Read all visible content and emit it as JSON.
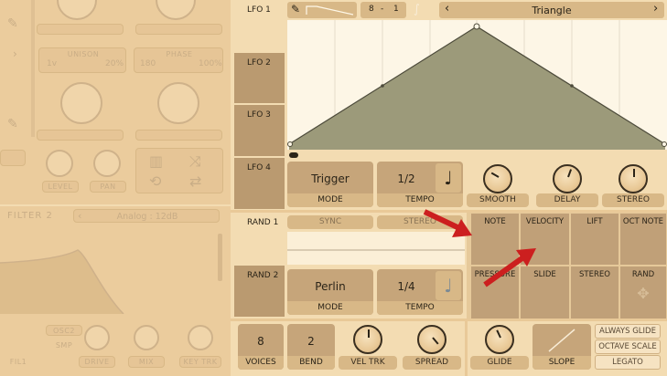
{
  "left": {
    "unison_label": "UNISON",
    "unison_min": "1v",
    "unison_max": "20%",
    "phase_label": "PHASE",
    "phase_min": "180",
    "phase_max": "100%",
    "level_label": "LEVEL",
    "pan_label": "PAN",
    "filter_title": "FILTER 2",
    "filter_type": "Analog : 12dB",
    "osc2_label": "OSC2",
    "smp_label": "SMP",
    "fil1_label": "FIL1",
    "drive_label": "DRIVE",
    "mix_label": "MIX",
    "keytrk_label": "KEY TRK"
  },
  "lfo": {
    "tabs": [
      "LFO 1",
      "LFO 2",
      "LFO 3",
      "LFO 4"
    ],
    "grid_num": "8",
    "grid_sep": "-",
    "grid_den": "1",
    "shape_name": "Triangle",
    "mode_value": "Trigger",
    "mode_label": "MODE",
    "tempo_value": "1/2",
    "tempo_label": "TEMPO",
    "smooth_label": "SMOOTH",
    "delay_label": "DELAY",
    "stereo_label": "STEREO"
  },
  "rand": {
    "tabs": [
      "RAND 1",
      "RAND 2"
    ],
    "sync_label": "SYNC",
    "stereo_label": "STEREO",
    "mode_value": "Perlin",
    "mode_label": "MODE",
    "tempo_value": "1/4",
    "tempo_label": "TEMPO"
  },
  "mod_grid": {
    "row1": [
      "NOTE",
      "VELOCITY",
      "LIFT",
      "OCT NOTE"
    ],
    "row2": [
      "PRESSURE",
      "SLIDE",
      "STEREO",
      "RAND"
    ]
  },
  "bottom": {
    "voices_value": "8",
    "voices_label": "VOICES",
    "bend_value": "2",
    "bend_label": "BEND",
    "veltrk_label": "VEL TRK",
    "spread_label": "SPREAD",
    "glide_label": "GLIDE",
    "slope_label": "SLOPE",
    "always_glide": "ALWAYS GLIDE",
    "octave_scale": "OCTAVE SCALE",
    "legato": "LEGATO"
  },
  "colors": {
    "accent": "#3a2f20",
    "arrow": "#cc1f1f",
    "wave_fill": "#9c9a7a"
  }
}
